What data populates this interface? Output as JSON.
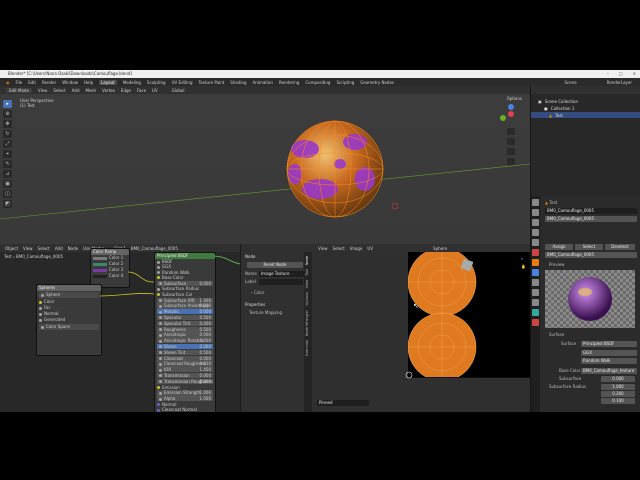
{
  "window": {
    "title": "Blender* [C:\\Users\\Nana Osaki\\Downloads\\Camouflage.blend]"
  },
  "menu": {
    "items": [
      "File",
      "Edit",
      "Render",
      "Window",
      "Help"
    ]
  },
  "workspaces": [
    "Layout",
    "Modeling",
    "Sculpting",
    "UV Editing",
    "Texture Paint",
    "Shading",
    "Animation",
    "Rendering",
    "Compositing",
    "Scripting",
    "Geometry Nodes"
  ],
  "workspace_active": "Layout",
  "scene": {
    "name": "Scene",
    "view_layer": "RenderLayer"
  },
  "viewport": {
    "mode": "Edit Mode",
    "menus": [
      "View",
      "Select",
      "Add",
      "Mesh",
      "Vertex",
      "Edge",
      "Face",
      "UV"
    ],
    "transform": "Global",
    "info_line1": "User Perspective",
    "info_line2": "(1) Test",
    "options": "Options"
  },
  "outliner": {
    "header": "Scene Collection",
    "items": [
      "Collection 1",
      "Test"
    ]
  },
  "properties": {
    "object": "Test",
    "material_slot": "BM0_Camouflage_0005",
    "material_name": "BM0_Camouflage_0005",
    "buttons": [
      "Assign",
      "Select",
      "Deselect"
    ],
    "preview_label": "Preview",
    "surface_label": "Surface",
    "surface_shader": "Principled BSDF",
    "distribution": "GGX",
    "subsurface_method": "Random Walk",
    "base_color_label": "Base Color",
    "base_color_value": "BM0_Camouflage_texture",
    "subsurface_label": "Subsurface",
    "subsurface_value": "0.000",
    "radius_label": "Subsurface Radius",
    "radius_values": [
      "1.000",
      "0.200",
      "0.100"
    ]
  },
  "node_editor": {
    "header_items": [
      "Object",
      "View",
      "Select",
      "Add",
      "Node",
      "Use Nodes"
    ],
    "slot": "Slot 1",
    "material": "BM0_Camouflage_0005",
    "breadcrumb": [
      "Test",
      "BM0_Camouflage_0005"
    ],
    "ramp_node": {
      "title": "Color Ramp",
      "rows": [
        "Color 1",
        "Color 2",
        "Color 3",
        "Color 4"
      ]
    },
    "sphere_node": {
      "title": "Spheres",
      "rows": [
        "Sphere",
        "Color",
        "Fac",
        "Normal",
        "Generated",
        "Color Space"
      ]
    },
    "bsdf_node": {
      "title": "Principled BSDF",
      "rows": [
        "BSDF",
        "GGX",
        "Random Walk",
        "Base Color",
        "Subsurface",
        "Subsurface Radius",
        "Subsurface Col",
        "Subsurface IOR",
        "Subsurface Anisotropy",
        "Metallic",
        "Specular",
        "Specular Tint",
        "Roughness",
        "Anisotropic",
        "Anisotropic Rotation",
        "Sheen",
        "Sheen Tint",
        "Clearcoat",
        "Clearcoat Roughness",
        "IOR",
        "Transmission",
        "Transmission Roughness",
        "Emission",
        "Emission Strength",
        "Alpha",
        "Normal",
        "Clearcoat Normal",
        "Tangent"
      ],
      "values": [
        "",
        "",
        "",
        "",
        "0.000",
        "",
        "",
        "1.400",
        "0.000",
        "0.000",
        "0.500",
        "0.000",
        "0.500",
        "0.000",
        "0.000",
        "0.000",
        "0.500",
        "0.000",
        "0.030",
        "1.450",
        "0.000",
        "0.000",
        "",
        "1.000",
        "1.000",
        "",
        "",
        ""
      ]
    }
  },
  "node_panel": {
    "section": "Node",
    "reset": "Reset Node",
    "name_label": "Name",
    "name_value": "Image Texture",
    "label_label": "Label",
    "color_label": "Color",
    "properties_label": "Properties",
    "texture_mapping": "Texture Mapping",
    "tabs": [
      "Node",
      "Tool",
      "View",
      "Options",
      "Node Wrangler",
      "Sverchok"
    ]
  },
  "uv_editor": {
    "menus": [
      "View",
      "Select",
      "Image",
      "UV"
    ],
    "image_name": "Sphere",
    "status": "Pinned"
  },
  "colors": {
    "accent": "#4772b3",
    "sphere_orange": "#e07a20",
    "sphere_purple": "#9a38c8"
  }
}
